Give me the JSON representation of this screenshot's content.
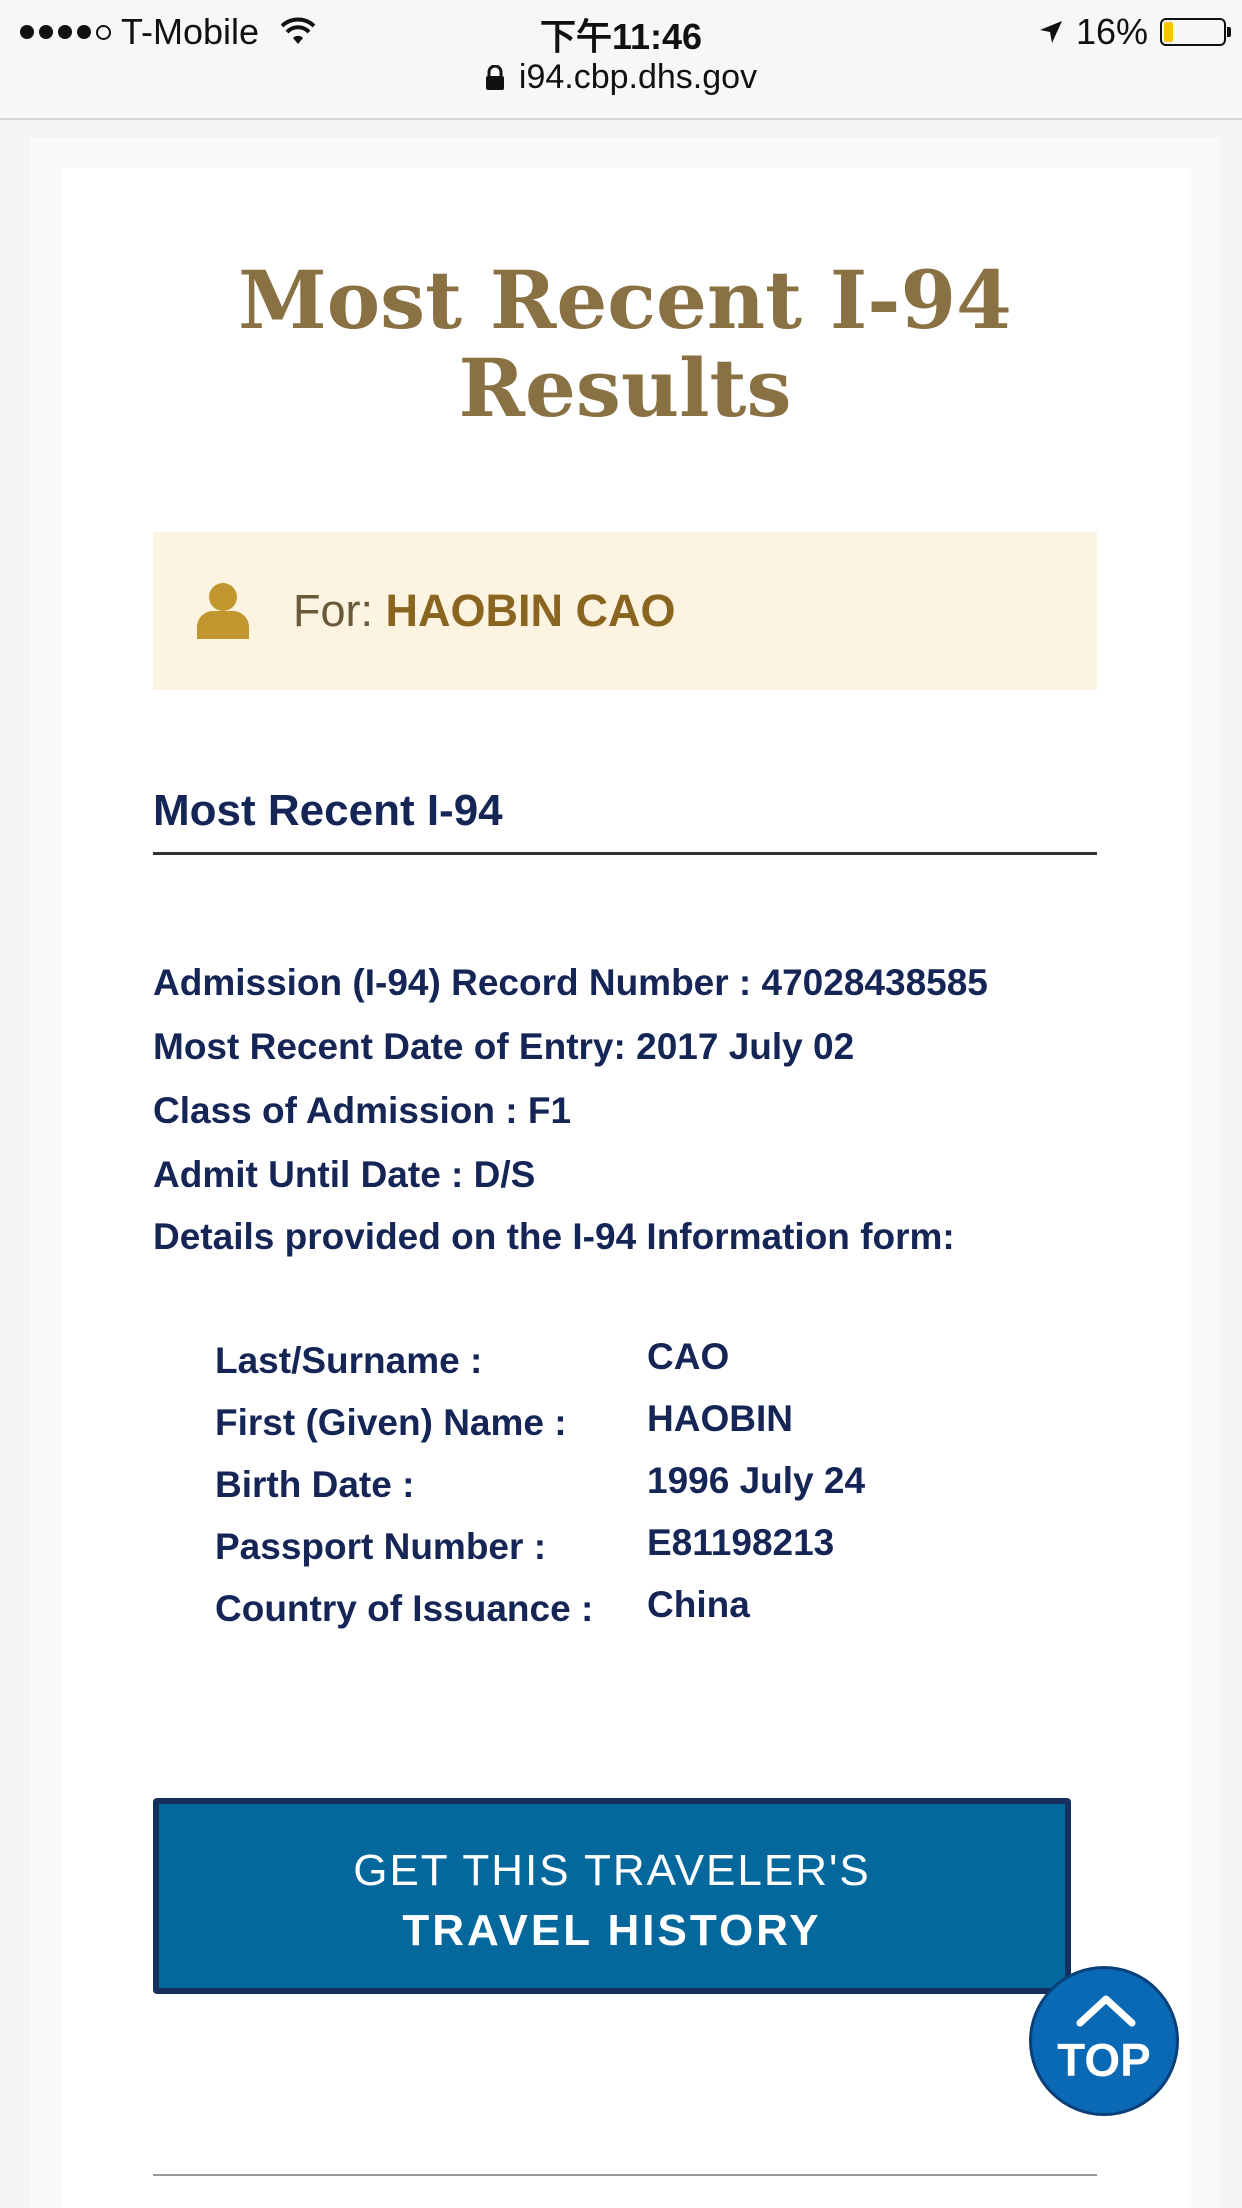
{
  "status_bar": {
    "carrier": "T-Mobile",
    "time": "下午11:46",
    "battery_percent": "16%",
    "battery_level": 0.16
  },
  "browser": {
    "url": "i94.cbp.dhs.gov"
  },
  "page": {
    "title_line1": "Most Recent I-94",
    "title_line2": "Results",
    "for_label": "For:",
    "for_name": "HAOBIN CAO",
    "section_title": "Most Recent I-94"
  },
  "record": {
    "record_number": "Admission (I-94) Record Number : 47028438585",
    "entry_date": "Most Recent Date of Entry: 2017 July 02",
    "class_of_admission": "Class of Admission : F1",
    "admit_until": "Admit Until Date : D/S",
    "details_intro": "Details provided on the I-94 Information form:"
  },
  "form_details": [
    {
      "label": "Last/Surname :",
      "value": "CAO"
    },
    {
      "label": "First (Given) Name :",
      "value": "HAOBIN"
    },
    {
      "label": "Birth Date :",
      "value": "1996 July 24"
    },
    {
      "label": "Passport Number :",
      "value": "E81198213"
    },
    {
      "label": "Country of Issuance :",
      "value": "China"
    }
  ],
  "actions": {
    "history_button_line1": "GET THIS TRAVELER'S",
    "history_button_line2": "TRAVEL HISTORY",
    "top_button_label": "TOP"
  },
  "colors": {
    "title_gold": "#8a7143",
    "banner_bg": "#fdf3e1",
    "navy_text": "#152556",
    "button_blue": "#05689c",
    "button_border": "#162f5c",
    "top_blue": "#0969b5"
  },
  "icons": [
    "wifi-icon",
    "lock-icon",
    "location-arrow-icon",
    "battery-icon",
    "person-icon",
    "chevron-up-icon"
  ]
}
